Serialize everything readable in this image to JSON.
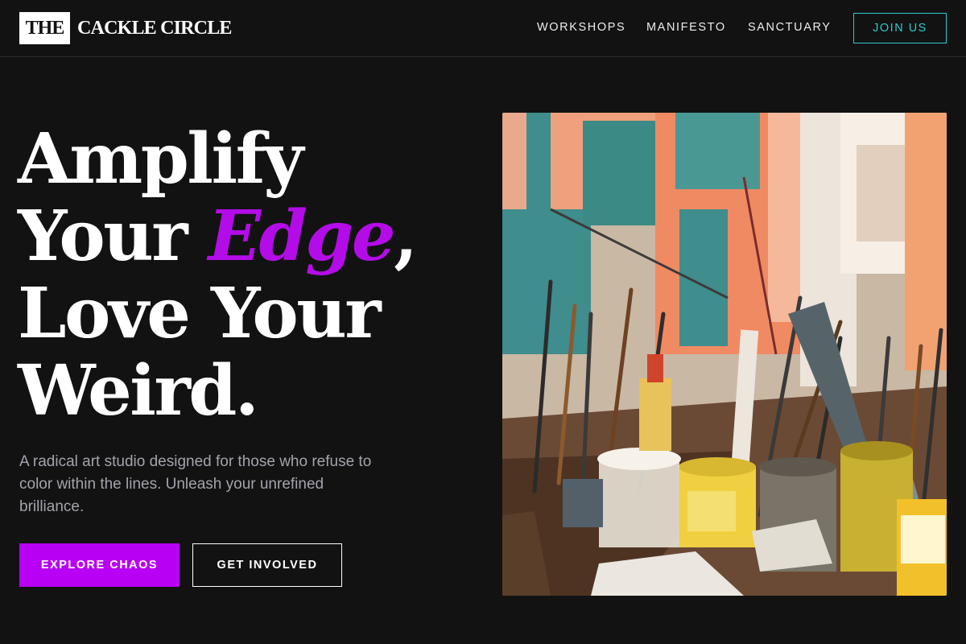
{
  "brand": {
    "logo_box": "THE",
    "logo_text": "CACKLE CIRCLE"
  },
  "nav": {
    "links": [
      "WORKSHOPS",
      "MANIFESTO",
      "SANCTUARY"
    ],
    "cta": "JOIN US"
  },
  "hero": {
    "headline": {
      "line1": "Amplify",
      "line2_pre": "Your ",
      "line2_accent": "Edge",
      "line2_post": ",",
      "line3": "Love Your",
      "line4": "Weird."
    },
    "subtitle": "A radical art studio designed for those who refuse to color within the lines. Unleash your unrefined brilliance.",
    "primary_button": "EXPLORE CHAOS",
    "secondary_button": "GET INVOLVED"
  },
  "colors": {
    "background": "#121212",
    "accent_purple": "#b800f5",
    "accent_teal": "#2bc9cf",
    "text_muted": "#a3a3ad"
  }
}
